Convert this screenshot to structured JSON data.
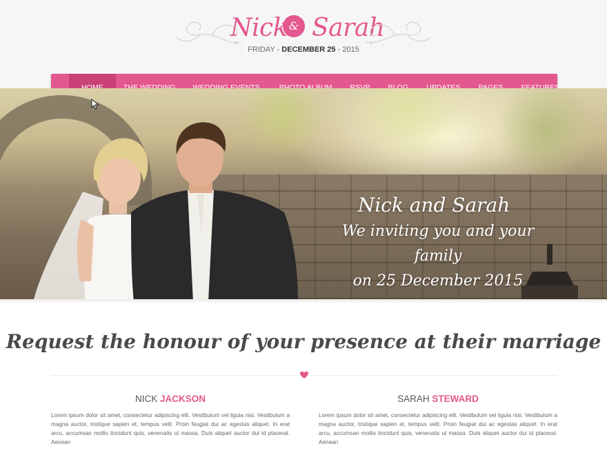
{
  "header": {
    "bride": "Nick",
    "ampersand": "&",
    "groom": "Sarah",
    "date_day": "FRIDAY",
    "date_main": "DECEMBER 25",
    "date_year": "2015"
  },
  "nav": {
    "items": [
      {
        "label": "HOME",
        "active": true
      },
      {
        "label": "THE WEDDING"
      },
      {
        "label": "WEDDING EVENTS"
      },
      {
        "label": "PHOTO ALBUM"
      },
      {
        "label": "RSVP"
      },
      {
        "label": "BLOG"
      },
      {
        "label": "UPDATES"
      },
      {
        "label": "PAGES"
      },
      {
        "label": "FEATURES"
      }
    ]
  },
  "hero": {
    "title": "Nick and Sarah",
    "line1": "We inviting you and your family",
    "line2": "on 25 December 2015"
  },
  "main": {
    "headline": "Request the honour of your presence at their marriage",
    "groom": {
      "first": "NICK",
      "last": "JACKSON",
      "bio": "Lorem ipsum dolor sit amet, consectetur adipiscing elit. Vestibulum vel ligula nisi. Vestibulum a magna auctor, tristique sapien et, tempus velit. Proin feugiat dui ac egestas aliquet. In erat arcu, accumsan mollis tincidunt quis, venenatis ut massa. Duis aliquet auctor dui id placerat. Aenean"
    },
    "bride": {
      "first": "SARAH",
      "last": "STEWARD",
      "bio": "Lorem ipsum dolor sit amet, consectetur adipiscing elit. Vestibulum vel ligula nisi. Vestibulum a magna auctor, tristique sapien et, tempus velit. Proin feugiat dui ac egestas aliquet. In erat arcu, accumsan mollis tincidunt quis, venenatis ut massa. Duis aliquet auctor dui id placerat. Aenean"
    }
  },
  "colors": {
    "accent": "#e3588e",
    "accent_dark": "#c94177"
  },
  "icons": [
    "flourish-icon",
    "heart-icon",
    "cursor-icon"
  ]
}
